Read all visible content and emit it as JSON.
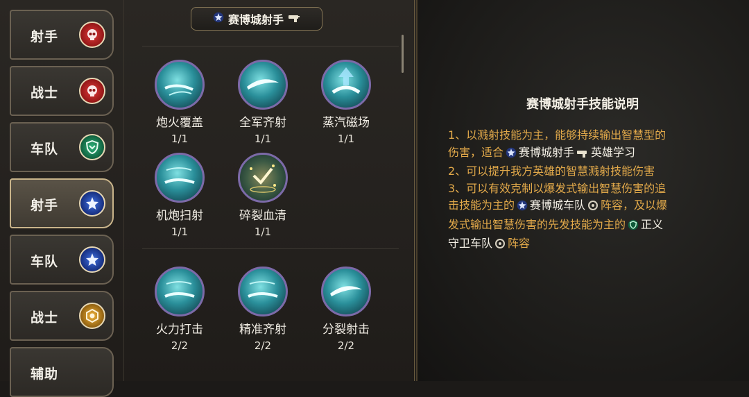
{
  "sidebar": {
    "items": [
      {
        "label": "射手",
        "badge_icon": "skull-icon",
        "badge_color": "#c42a2a",
        "active": false
      },
      {
        "label": "战士",
        "badge_icon": "skull-icon",
        "badge_color": "#c42a2a",
        "active": false
      },
      {
        "label": "车队",
        "badge_icon": "shield-icon",
        "badge_color": "#1f8a5a",
        "active": false
      },
      {
        "label": "射手",
        "badge_icon": "star-icon",
        "badge_color": "#2a4fb8",
        "active": true
      },
      {
        "label": "车队",
        "badge_icon": "star-icon",
        "badge_color": "#2a4fb8",
        "active": false
      },
      {
        "label": "战士",
        "badge_icon": "hexagon-icon",
        "badge_color": "#d89a22",
        "active": false
      },
      {
        "label": "辅助",
        "badge_icon": "",
        "badge_color": "",
        "active": false
      }
    ]
  },
  "header": {
    "title": "赛博城射手",
    "left_icon": "star-icon",
    "right_icon": "gun-icon"
  },
  "skills_top": [
    {
      "name": "炮火覆盖",
      "count": "1/1",
      "icon": "barrage-icon"
    },
    {
      "name": "全军齐射",
      "count": "1/1",
      "icon": "volley-icon"
    },
    {
      "name": "蒸汽磁场",
      "count": "1/1",
      "icon": "steam-field-icon"
    },
    {
      "name": "机炮扫射",
      "count": "1/1",
      "icon": "strafe-icon"
    },
    {
      "name": "碎裂血清",
      "count": "1/1",
      "icon": "serum-icon"
    }
  ],
  "skills_bottom": [
    {
      "name": "火力打击",
      "count": "2/2",
      "icon": "strike-icon"
    },
    {
      "name": "精准齐射",
      "count": "2/2",
      "icon": "precise-volley-icon"
    },
    {
      "name": "分裂射击",
      "count": "2/2",
      "icon": "split-shot-icon"
    }
  ],
  "description": {
    "title": "赛博城射手技能说明",
    "line1": "1、以溅射技能为主，能够持续输出智慧型的",
    "line2a": "伤害，适合",
    "line2b": "赛博城射手",
    "line2c": "英雄学习",
    "line3": "2、可以提升我方英雄的智慧溅射技能伤害",
    "line4": "3、可以有效克制以爆发式输出智慧伤害的追",
    "line5a": "击技能为主的",
    "line5b": "赛博城车队",
    "line5c": "阵容，及以爆",
    "line6a": "发式输出智慧伤害的先发技能为主的",
    "line6b": "正义",
    "line7a": "守卫车队",
    "line7b": "阵容"
  },
  "colors": {
    "accent_text": "#e2a94a",
    "active_border": "#c9b48a"
  }
}
